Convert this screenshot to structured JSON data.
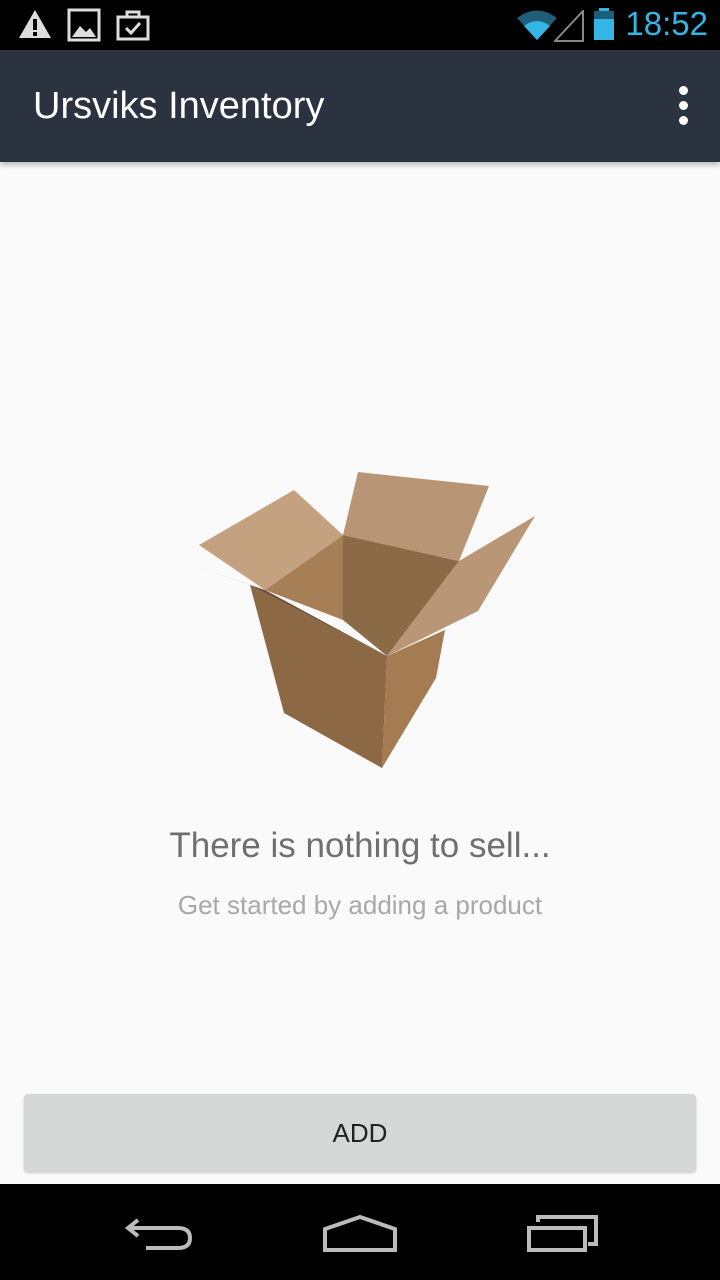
{
  "status_bar": {
    "time": "18:52",
    "icons": [
      "warning-icon",
      "image-icon",
      "briefcase-check-icon",
      "wifi-icon",
      "signal-icon",
      "battery-icon"
    ],
    "clock_color": "#33b5e5"
  },
  "app_bar": {
    "title": "Ursviks Inventory",
    "background": "#2c3340",
    "menu_icon": "overflow-menu-icon"
  },
  "empty_state": {
    "illustration": "open-cardboard-box",
    "title": "There is nothing to sell...",
    "subtitle": "Get started by adding a product"
  },
  "actions": {
    "add_label": "ADD"
  },
  "nav_bar": {
    "buttons": [
      "back-icon",
      "home-icon",
      "recent-apps-icon"
    ]
  }
}
